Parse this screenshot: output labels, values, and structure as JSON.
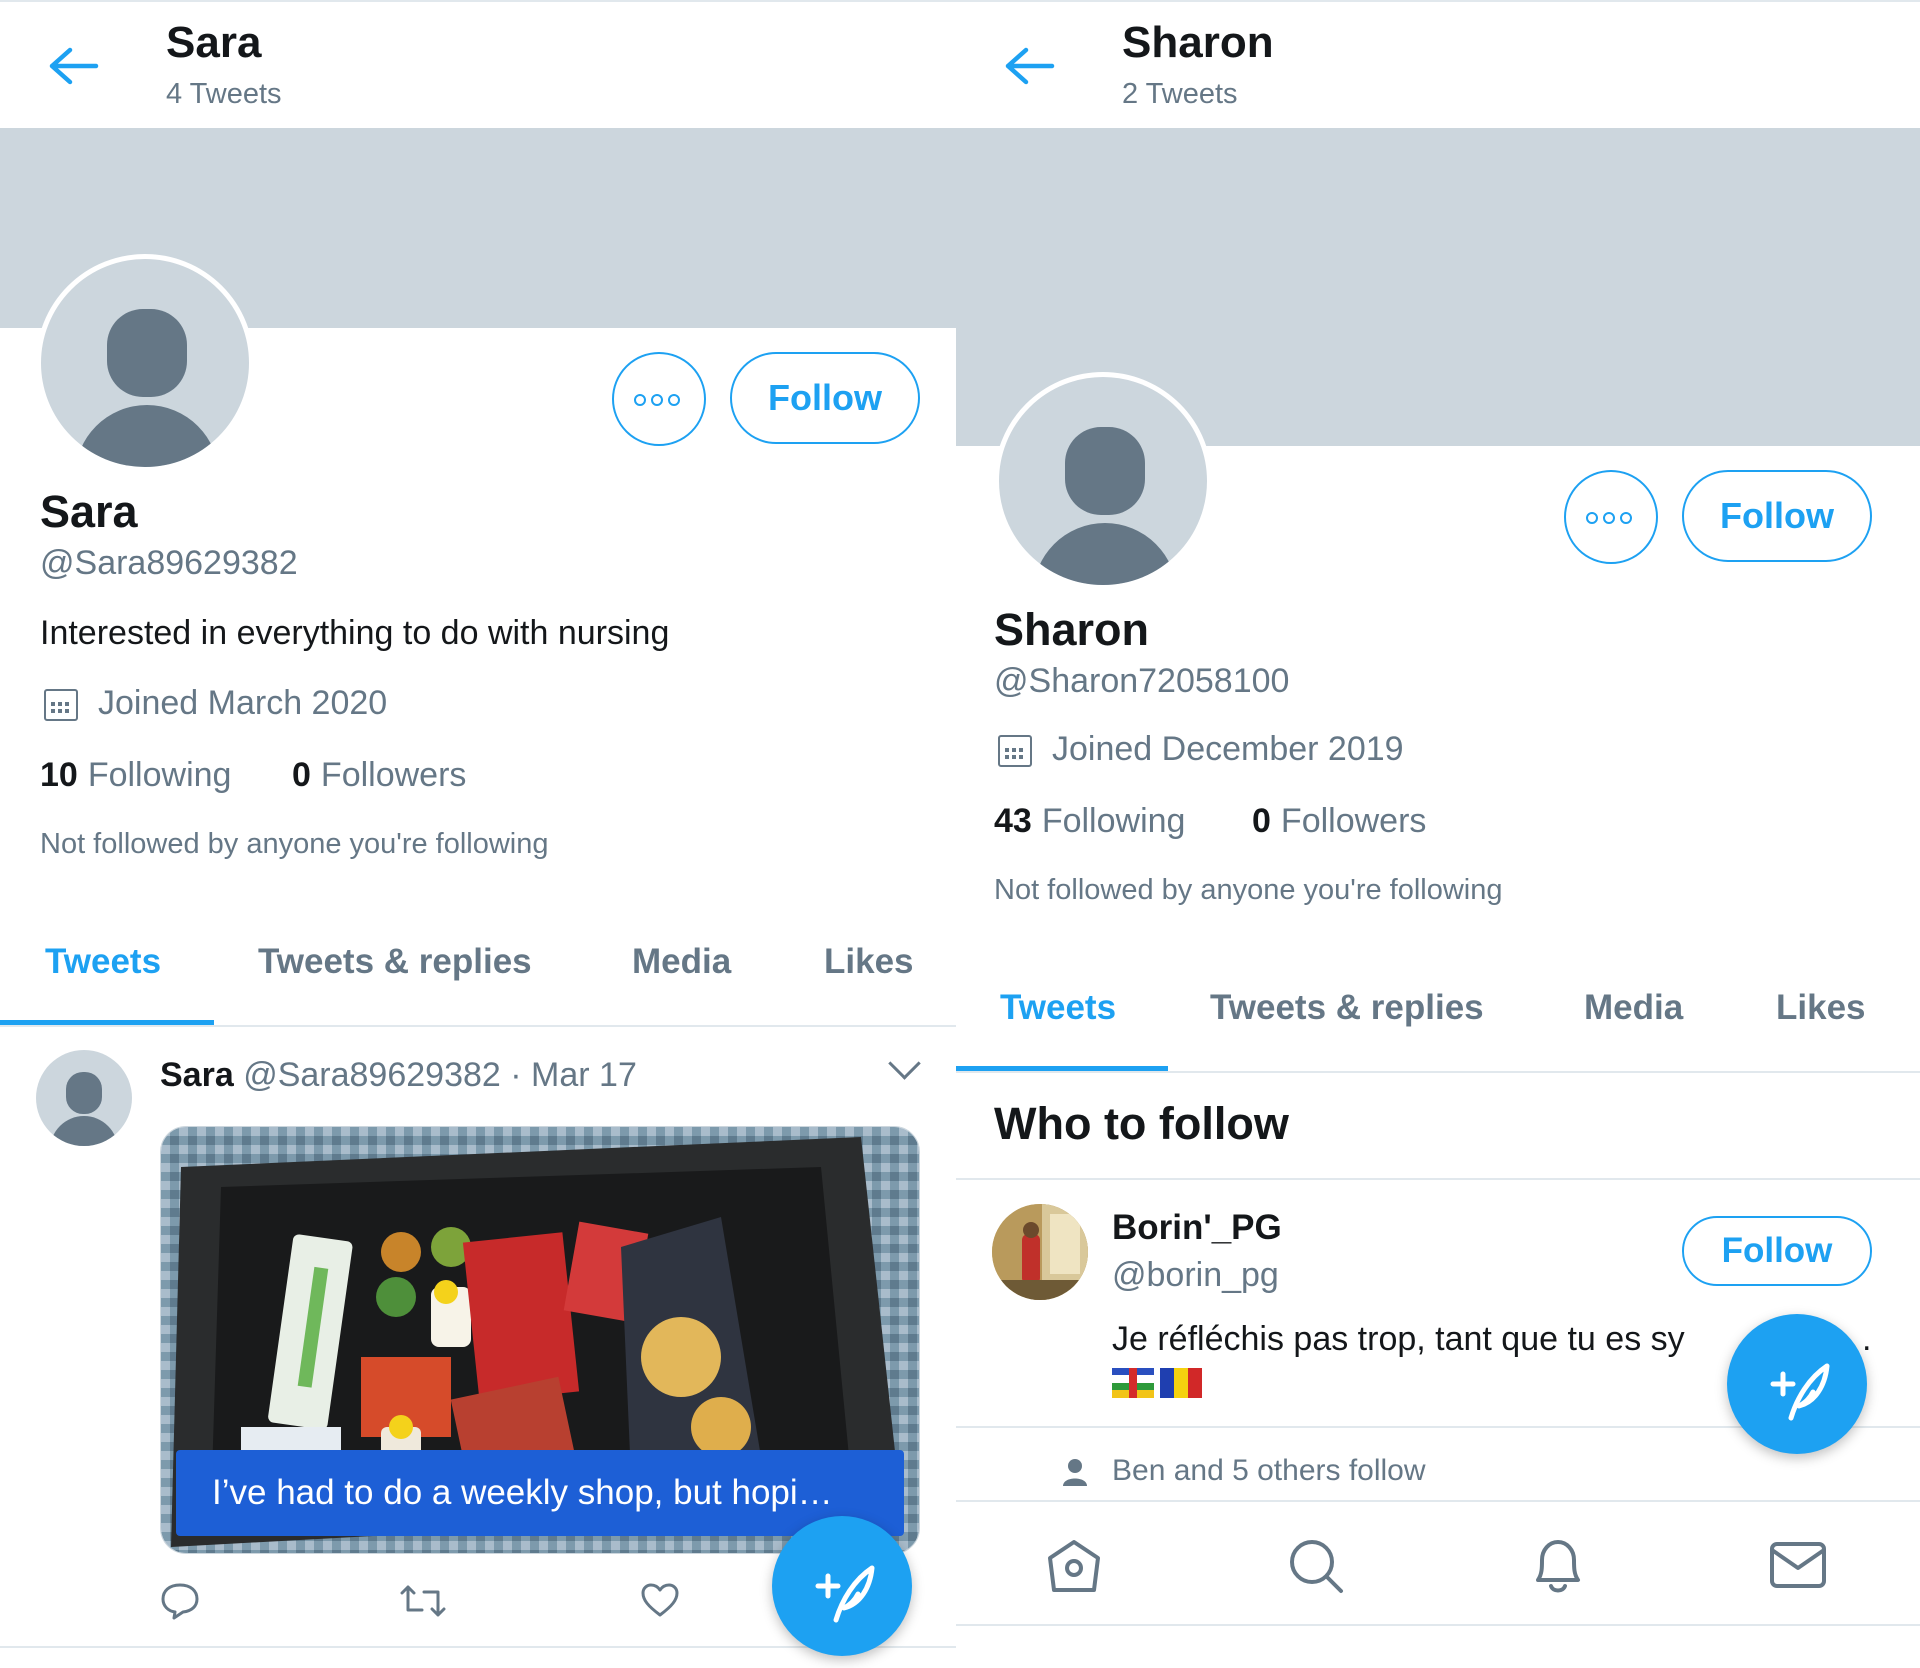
{
  "left": {
    "header": {
      "name": "Sara",
      "count": "4 Tweets"
    },
    "profile": {
      "name": "Sara",
      "handle": "@Sara89629382",
      "bio": "Interested in everything to do with nursing",
      "joined": "Joined March 2020",
      "following_count": "10",
      "following_label": "Following",
      "followers_count": "0",
      "followers_label": "Followers",
      "note": "Not followed by anyone you're following",
      "follow_label": "Follow"
    },
    "tabs": [
      "Tweets",
      "Tweets & replies",
      "Media",
      "Likes"
    ],
    "tweet": {
      "name": "Sara",
      "handle": "@Sara89629382",
      "sep": "·",
      "date": "Mar 17",
      "caption": "I’ve had to do a weekly shop, but hopi…"
    }
  },
  "right": {
    "header": {
      "name": "Sharon",
      "count": "2 Tweets"
    },
    "profile": {
      "name": "Sharon",
      "handle": "@Sharon72058100",
      "joined": "Joined December 2019",
      "following_count": "43",
      "following_label": "Following",
      "followers_count": "0",
      "followers_label": "Followers",
      "note": "Not followed by anyone you're following",
      "follow_label": "Follow"
    },
    "tabs": [
      "Tweets",
      "Tweets & replies",
      "Media",
      "Likes"
    ],
    "who_to_follow": {
      "title": "Who to follow",
      "name": "Borin'_PG",
      "handle": "@borin_pg",
      "bio": "Je réfléchis pas trop, tant que tu es sy",
      "bio_tail": ".",
      "follow_label": "Follow",
      "social": "Ben and 5 others follow"
    }
  },
  "icons": {
    "back": "back-arrow-icon",
    "more": "more-options-icon",
    "calendar": "calendar-icon",
    "compose": "compose-tweet-icon",
    "reply": "reply-icon",
    "retweet": "retweet-icon",
    "like": "like-icon",
    "home": "home-icon",
    "search": "search-icon",
    "notifications": "bell-icon",
    "messages": "mail-icon"
  },
  "colors": {
    "accent": "#1da1f2",
    "banner": "#ccd6dd",
    "secondary_text": "#657786",
    "caption_bg": "#1d5fd6"
  }
}
